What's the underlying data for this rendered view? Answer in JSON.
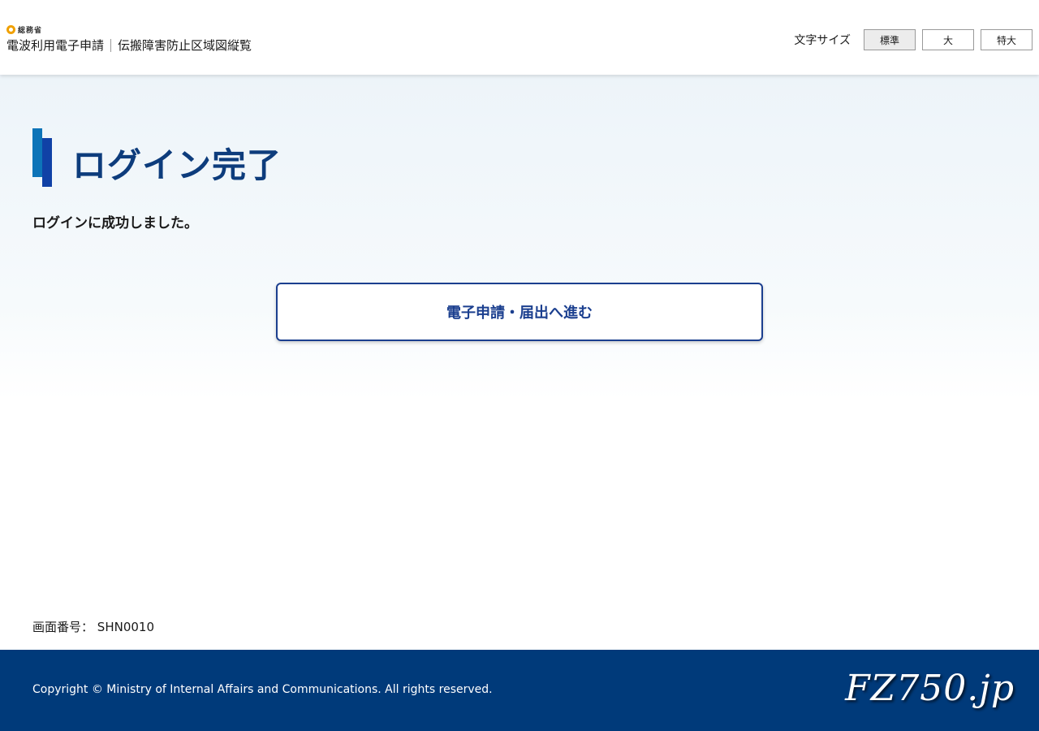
{
  "header": {
    "ministry_name": "総務省",
    "app_name": "電波利用電子申請",
    "app_subname": "伝搬障害防止区域図縦覧",
    "font_size": {
      "label": "文字サイズ",
      "options": [
        "標準",
        "大",
        "特大"
      ],
      "selected": "標準"
    }
  },
  "main": {
    "title": "ログイン完了",
    "message": "ログインに成功しました。",
    "proceed_button": "電子申請・届出へ進む",
    "screen_no_label": "画面番号：",
    "screen_no": "SHN0010"
  },
  "footer": {
    "copyright": "Copyright © Ministry of Internal Affairs and Communications. All rights reserved.",
    "watermark": "FZ750.jp"
  },
  "colors": {
    "title": "#0d3c7c",
    "accent_bar_1": "#0d74b8",
    "accent_bar_2": "#1041a6",
    "button_border": "#1b3f8f",
    "footer_bg": "#003a7a",
    "ministry_logo": "#f0a000"
  },
  "icons": {
    "ministry_logo": "ministry-logo-icon"
  }
}
